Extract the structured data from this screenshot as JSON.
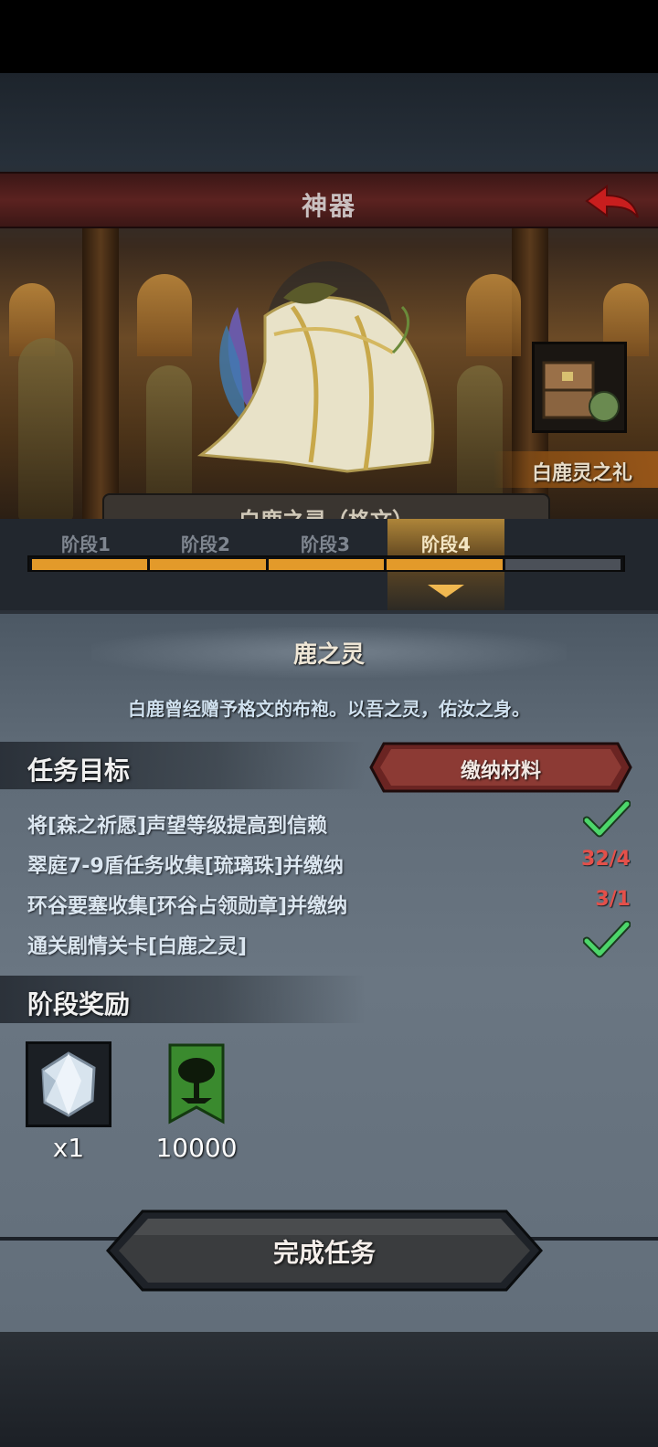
{
  "header": {
    "title": "神器"
  },
  "artifact": {
    "gift_label": "白鹿灵之礼",
    "name_plate": "白鹿之灵（格文）"
  },
  "stages": [
    {
      "label": "阶段1",
      "active": false
    },
    {
      "label": "阶段2",
      "active": false
    },
    {
      "label": "阶段3",
      "active": false
    },
    {
      "label": "阶段4",
      "active": true
    }
  ],
  "progress": {
    "completed_segments": 4,
    "total_segments": 5
  },
  "stage_detail": {
    "title": "鹿之灵",
    "description": "白鹿曾经赠予格文的布袍。以吾之灵，佑汝之身。"
  },
  "tasks": {
    "header": "任务目标",
    "submit_label": "缴纳材料",
    "items": [
      {
        "text": "将[森之祈愿]声望等级提高到信赖",
        "status": "",
        "done": true
      },
      {
        "text": "翠庭7-9盾任务收集[琉璃珠]并缴纳",
        "status": "32/4",
        "done": false
      },
      {
        "text": "环谷要塞收集[环谷占领勋章]并缴纳",
        "status": "3/1",
        "done": false
      },
      {
        "text": "通关剧情关卡[白鹿之灵]",
        "status": "",
        "done": true
      }
    ]
  },
  "rewards": {
    "header": "阶段奖励",
    "items": [
      {
        "icon": "crystal-icon",
        "amount": "x1"
      },
      {
        "icon": "forest-banner-icon",
        "amount": "10000"
      }
    ]
  },
  "complete_button": {
    "label": "完成任务"
  },
  "colors": {
    "progress": "#e39a2a",
    "status_red": "#e3504a",
    "check_green": "#4cd66a",
    "title_bar": "#5b2220"
  }
}
